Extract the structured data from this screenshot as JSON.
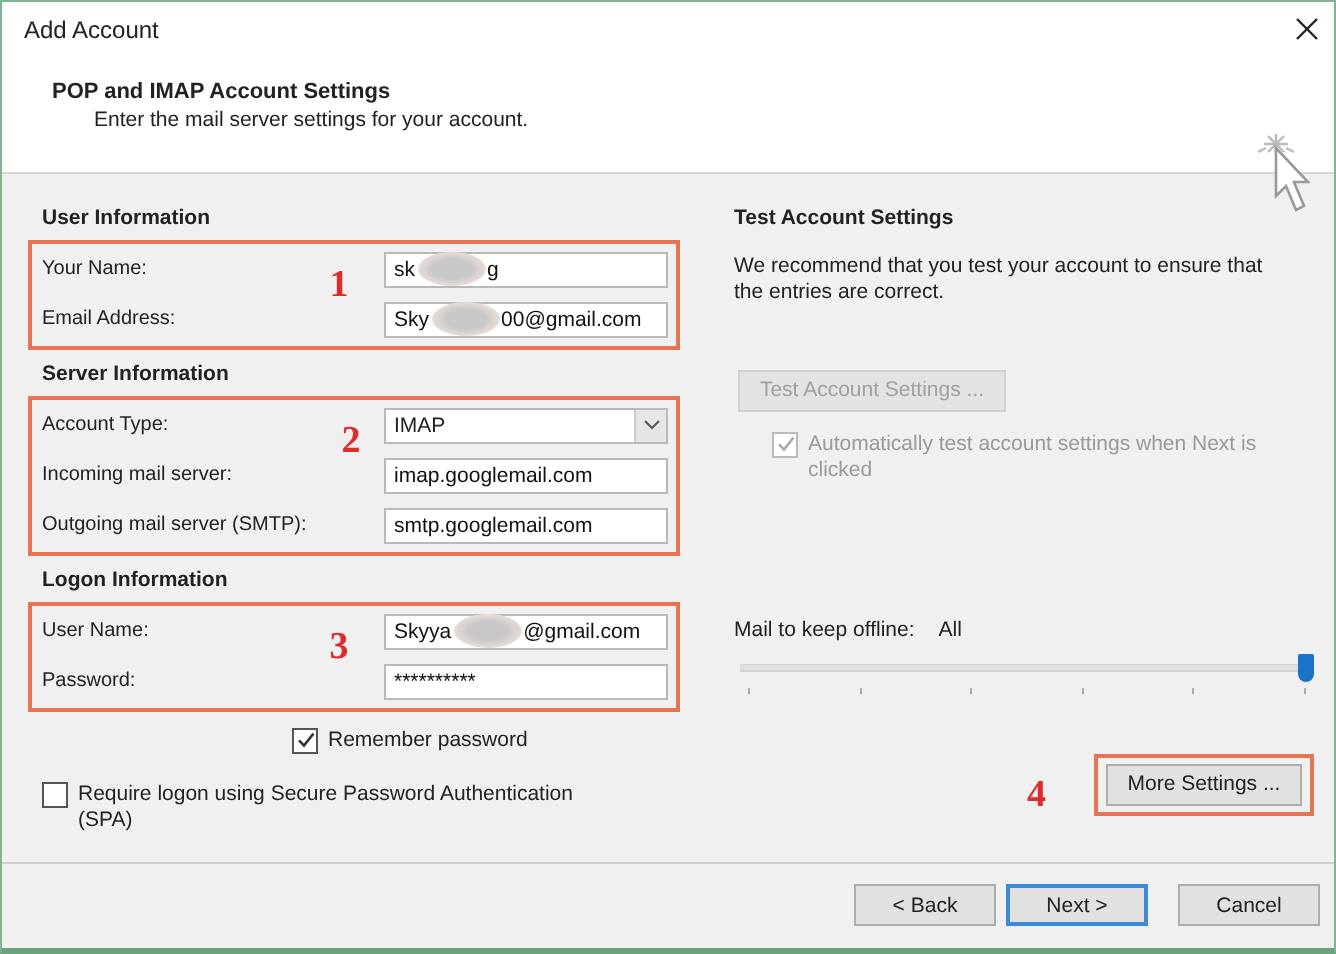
{
  "window": {
    "title": "Add Account"
  },
  "header": {
    "title": "POP and IMAP Account Settings",
    "subtitle": "Enter the mail server settings for your account."
  },
  "sections": [
    {
      "heading": "User Information",
      "annotation": "1",
      "fields": [
        {
          "label": "Your Name:",
          "kind": "text",
          "value": "sk",
          "value_end": "g",
          "redacted": true
        },
        {
          "label": "Email Address:",
          "kind": "text",
          "value": "Sky",
          "value_end": "00@gmail.com",
          "redacted": true
        }
      ]
    },
    {
      "heading": "Server Information",
      "annotation": "2",
      "fields": [
        {
          "label": "Account Type:",
          "kind": "dropdown",
          "value": "IMAP"
        },
        {
          "label": "Incoming mail server:",
          "kind": "text",
          "value": "imap.googlemail.com"
        },
        {
          "label": "Outgoing mail server (SMTP):",
          "kind": "text",
          "value": "smtp.googlemail.com"
        }
      ]
    },
    {
      "heading": "Logon Information",
      "annotation": "3",
      "fields": [
        {
          "label": "User Name:",
          "kind": "text",
          "value": "Skyya",
          "value_end": "@gmail.com",
          "redacted": true
        },
        {
          "label": "Password:",
          "kind": "text",
          "value": "**********"
        }
      ]
    }
  ],
  "remember_password": {
    "label": "Remember password",
    "checked": true
  },
  "spa": {
    "label": "Require logon using Secure Password Authentication (SPA)",
    "checked": false
  },
  "test_settings": {
    "heading": "Test Account Settings",
    "description": "We recommend that you test your account to ensure that the entries are correct.",
    "button": {
      "label": "Test Account Settings ...",
      "disabled": true
    },
    "auto_test": {
      "label": "Automatically test account settings when Next is clicked",
      "checked": true,
      "disabled": true
    }
  },
  "offline": {
    "label": "Mail to keep offline:",
    "value": "All",
    "level": 1
  },
  "more_settings": {
    "label": "More Settings ...",
    "annotation": "4"
  },
  "buttons": [
    {
      "label": "< Back",
      "default": false
    },
    {
      "label": "Next >",
      "default": true
    },
    {
      "label": "Cancel",
      "default": false
    }
  ]
}
